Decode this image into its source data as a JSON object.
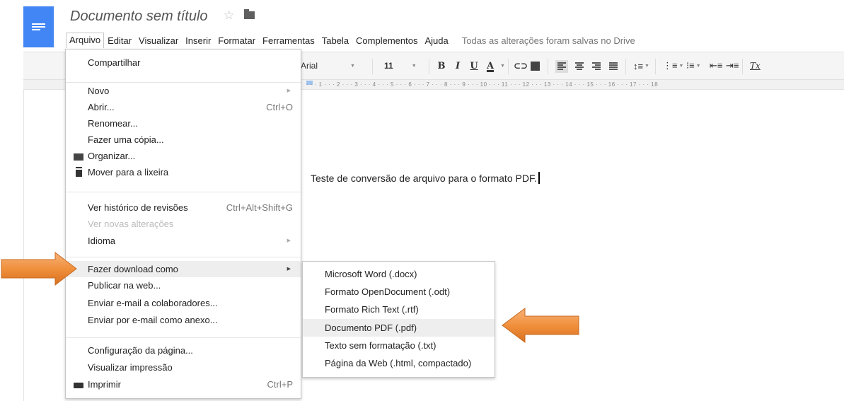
{
  "app": {
    "doc_title": "Documento sem título",
    "star_icon": "star-outline-icon",
    "folder_icon": "folder-icon",
    "brand_color": "#4285f4"
  },
  "menubar": {
    "items": [
      "Arquivo",
      "Editar",
      "Visualizar",
      "Inserir",
      "Formatar",
      "Ferramentas",
      "Tabela",
      "Complementos",
      "Ajuda"
    ],
    "saved_status": "Todas as alterações foram salvas no Drive"
  },
  "toolbar": {
    "font": "Arial",
    "size": "11",
    "bold": "B",
    "italic": "I",
    "underline": "U",
    "text_color": "A",
    "link": "⊂⊃",
    "clear_format": "Tx"
  },
  "ruler": {
    "marks": "· · · 1 · · · 2 · · · 3 · · · 4 · · · 5 · · · 6 · · · 7 · · · 8 · · · 9 · · · 10 · · · 11 · · · 12 · · · 13 · · · 14 · · · 15 · · · 16 · · · 17 · · · 18"
  },
  "document": {
    "text": "Teste de conversão de arquivo para o formato PDF."
  },
  "file_menu": {
    "share": "Compartilhar",
    "new": "Novo",
    "open": "Abrir...",
    "open_shortcut": "Ctrl+O",
    "rename": "Renomear...",
    "copy": "Fazer uma cópia...",
    "organize": "Organizar...",
    "trash": "Mover para a lixeira",
    "history": "Ver histórico de revisões",
    "history_shortcut": "Ctrl+Alt+Shift+G",
    "new_changes": "Ver novas alterações",
    "language": "Idioma",
    "download": "Fazer download como",
    "publish": "Publicar na web...",
    "email_collab": "Enviar e-mail a colaboradores...",
    "email_attach": "Enviar por e-mail como anexo...",
    "page_setup": "Configuração da página...",
    "print_preview": "Visualizar impressão",
    "print": "Imprimir",
    "print_shortcut": "Ctrl+P"
  },
  "download_submenu": {
    "items": [
      "Microsoft Word (.docx)",
      "Formato OpenDocument (.odt)",
      "Formato Rich Text (.rtf)",
      "Documento PDF (.pdf)",
      "Texto sem formatação (.txt)",
      "Página da Web (.html, compactado)"
    ],
    "highlighted": "Documento PDF (.pdf)"
  },
  "callouts": {
    "color": "#f0903c"
  }
}
